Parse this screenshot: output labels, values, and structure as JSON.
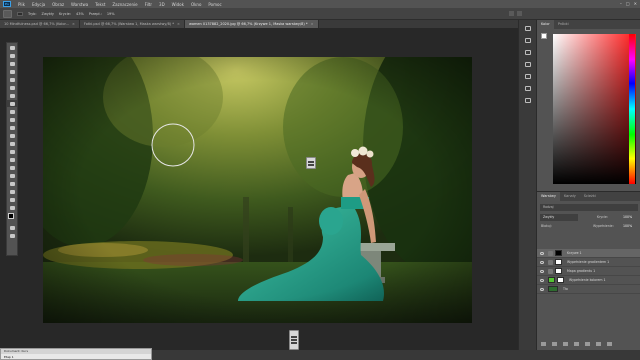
{
  "menubar": {
    "logo": "Ps",
    "items": [
      "Plik",
      "Edycja",
      "Obraz",
      "Warstwa",
      "Tekst",
      "Zaznaczenie",
      "Filtr",
      "3D",
      "Widok",
      "Okno",
      "Pomoc"
    ],
    "window_controls": [
      "–",
      "□",
      "✕"
    ]
  },
  "optionsbar": {
    "labels": [
      "Tryb:",
      "Zwykły",
      "Krycie:",
      "43%",
      "Przepł.:",
      "19%"
    ]
  },
  "tabs": [
    {
      "label": "10 Mindfulness.psd @ 66,7% (Kolor...",
      "active": false
    },
    {
      "label": "Fotki.psd @ 66,7% (Warstwa 1, Maska warstwy/8) *",
      "active": false
    },
    {
      "label": "women 0137882_2020.jpg @ 66,7% (Krzywe 1, Maska warstwy/8) *",
      "active": true
    }
  ],
  "colors": {
    "chrome": "#535353",
    "panel_selected": "#656565",
    "accent_green": "#2e6b2f"
  },
  "color_panel": {
    "tabs": [
      "Kolor",
      "Próbki"
    ]
  },
  "layers_panel": {
    "tabs": [
      "Warstwy",
      "Kanały",
      "Ścieżki"
    ],
    "search_placeholder": "Rodzaj",
    "blend_mode": "Zwykły",
    "opacity_label": "Krycie:",
    "opacity_value": "100%",
    "lock_label": "Blokuj:",
    "fill_label": "Wypełnienie:",
    "fill_value": "100%",
    "layers": [
      {
        "name": "Krzywe 1",
        "thumb": "#000000",
        "selected": true
      },
      {
        "name": "Wypełnienie gradientem 1",
        "thumb": "#ffffff",
        "selected": false
      },
      {
        "name": "Mapa gradientu 1",
        "thumb": "#ffffff",
        "selected": false
      },
      {
        "name": "Wypełnienie kolorem 1",
        "thumb": "#54c232",
        "selected": false
      },
      {
        "name": "Tło",
        "thumb": "#2e6b2f",
        "selected": false
      }
    ]
  },
  "mini_window": {
    "title": "Dokument: Kurs",
    "body": "Etap 1"
  }
}
